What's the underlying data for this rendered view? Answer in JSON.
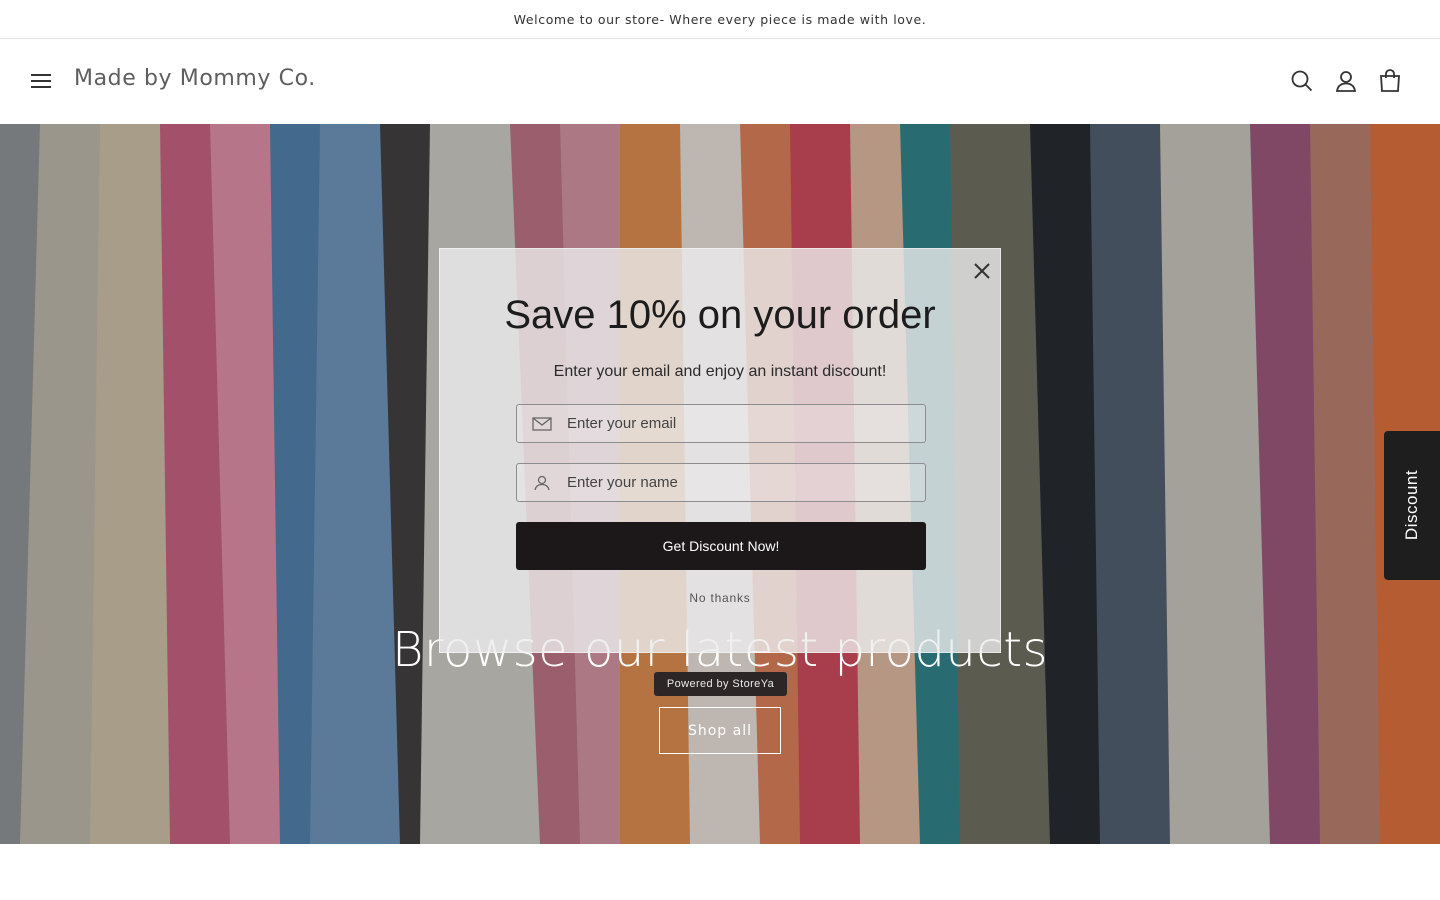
{
  "announcement": {
    "text": "Welcome to our store- Where every piece is made with love."
  },
  "header": {
    "logo": "Made by Mommy Co.",
    "icons": [
      "menu-icon",
      "search-icon",
      "account-icon",
      "cart-icon"
    ]
  },
  "hero": {
    "title": "Browse our latest products",
    "button_label": "Shop all"
  },
  "popup": {
    "title": "Save 10% on your order",
    "subtitle": "Enter your email and enjoy an instant discount!",
    "email_placeholder": "Enter your email",
    "name_placeholder": "Enter your name",
    "cta_label": "Get Discount Now!",
    "dismiss_label": "No thanks",
    "powered_label": "Powered by StoreYa"
  },
  "side_tab": {
    "label": "Discount"
  },
  "colors": {
    "cta": "#1c1819",
    "popup_bg": "#ecece e",
    "text_dark": "#121212"
  }
}
